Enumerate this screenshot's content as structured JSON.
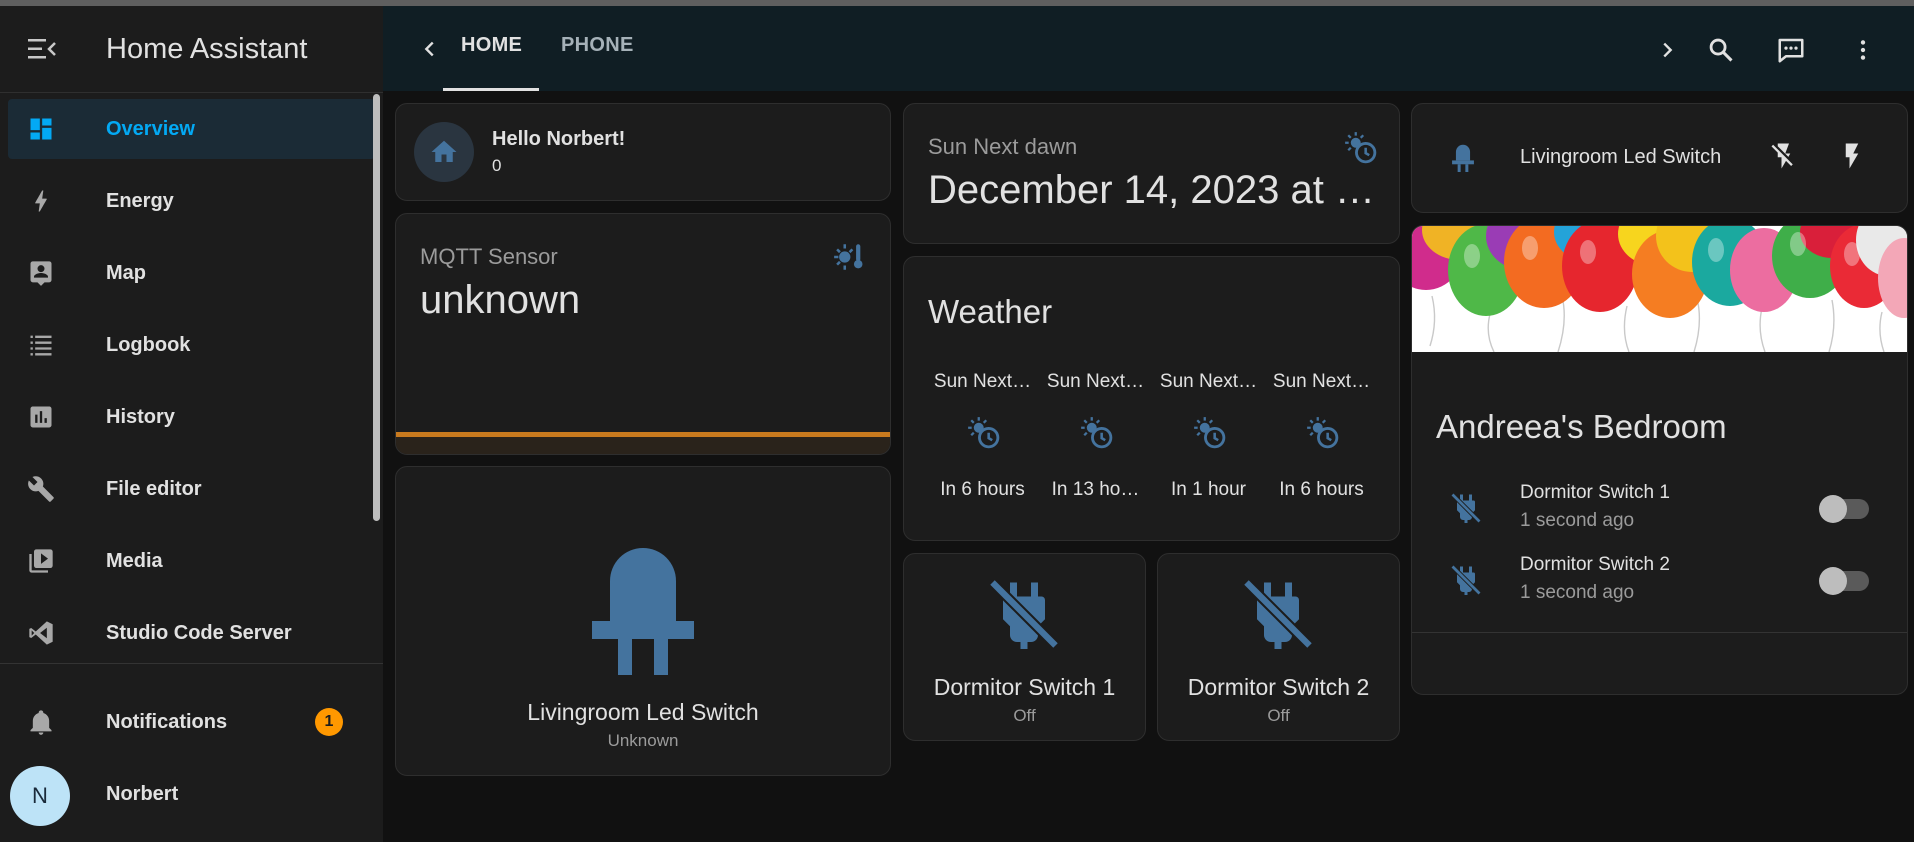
{
  "app": {
    "title": "Home Assistant"
  },
  "sidebar": {
    "items": [
      {
        "label": "Overview",
        "icon": "dashboard-icon",
        "active": true
      },
      {
        "label": "Energy",
        "icon": "lightning-icon"
      },
      {
        "label": "Map",
        "icon": "map-person-icon"
      },
      {
        "label": "Logbook",
        "icon": "list-icon"
      },
      {
        "label": "History",
        "icon": "chart-box-icon"
      },
      {
        "label": "File editor",
        "icon": "wrench-icon"
      },
      {
        "label": "Media",
        "icon": "play-box-multiple-icon"
      },
      {
        "label": "Studio Code Server",
        "icon": "vscode-icon"
      }
    ],
    "notifications": {
      "label": "Notifications",
      "count": "1"
    },
    "user": {
      "initial": "N",
      "name": "Norbert"
    }
  },
  "topbar": {
    "tabs": [
      "HOME",
      "PHONE"
    ],
    "active_tab": "HOME"
  },
  "cards": {
    "greeting": {
      "title": "Hello Norbert!",
      "subtitle": "0"
    },
    "mqtt": {
      "name": "MQTT Sensor",
      "state": "unknown"
    },
    "led_big": {
      "name": "Livingroom Led Switch",
      "state": "Unknown"
    },
    "sun": {
      "name": "Sun Next dawn",
      "value": "December 14, 2023 at …"
    },
    "weather": {
      "title": "Weather",
      "forecast": [
        {
          "name": "Sun Next…",
          "value": "In 6 hours"
        },
        {
          "name": "Sun Next…",
          "value": "In 13 ho…"
        },
        {
          "name": "Sun Next…",
          "value": "In 1 hour"
        },
        {
          "name": "Sun Next…",
          "value": "In 6 hours"
        }
      ]
    },
    "switch1": {
      "name": "Dormitor Switch 1",
      "state": "Off"
    },
    "switch2": {
      "name": "Dormitor Switch 2",
      "state": "Off"
    },
    "led_row": {
      "name": "Livingroom Led Switch"
    },
    "bedroom": {
      "title": "Andreea's Bedroom",
      "rows": [
        {
          "name": "Dormitor Switch 1",
          "time": "1 second ago"
        },
        {
          "name": "Dormitor Switch 2",
          "time": "1 second ago"
        }
      ]
    }
  },
  "colors": {
    "accent": "#03a9f4",
    "icon_blue": "#44739e",
    "badge": "#ff9800",
    "mqtt_bar": "#c97a1e"
  }
}
